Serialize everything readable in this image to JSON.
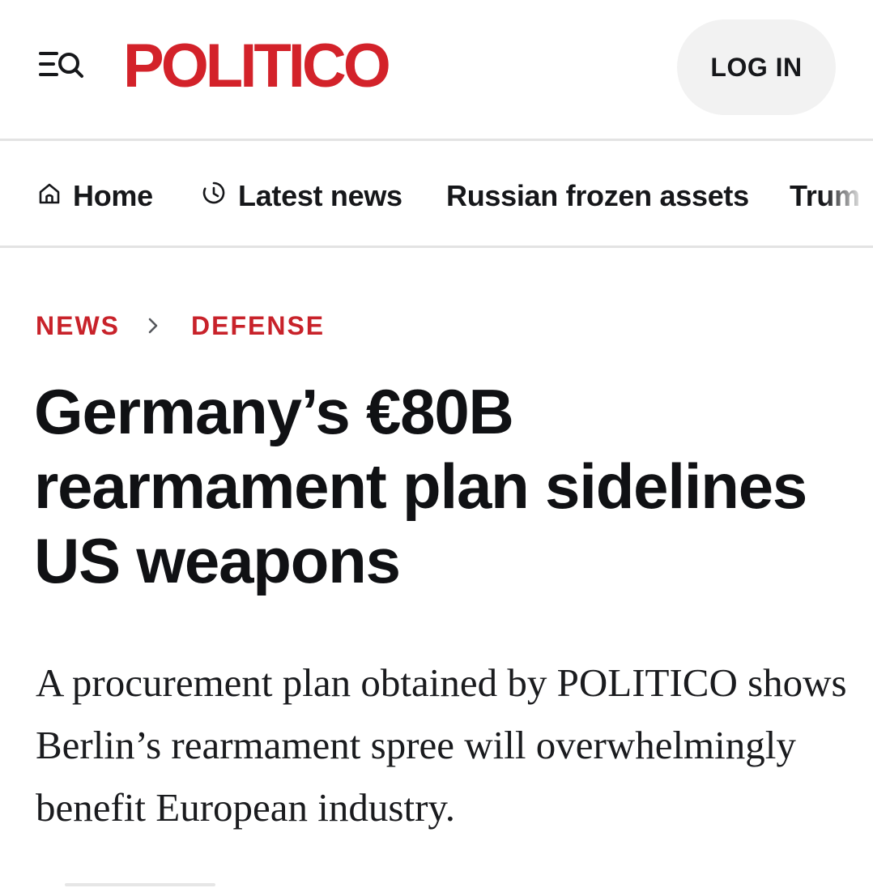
{
  "header": {
    "menu_icon": "menu-search-icon",
    "logo_text": "POLITICO",
    "login_label": "LOG IN",
    "brand_color": "#d3222a"
  },
  "nav": {
    "items": [
      {
        "label": "Home",
        "icon": "home-icon"
      },
      {
        "label": "Latest news",
        "icon": "clock-icon"
      },
      {
        "label": "Russian frozen assets"
      },
      {
        "label": "Trum"
      }
    ]
  },
  "article": {
    "breadcrumb": {
      "section": "NEWS",
      "subsection": "DEFENSE",
      "separator_icon": "chevron-right-icon"
    },
    "headline": "Germany’s €80B rearmament plan sidelines US weapons",
    "dek": "A procurement plan obtained by POLITICO shows Berlin’s rearmament spree will overwhelmingly benefit European industry."
  },
  "colors": {
    "accent": "#c8222a",
    "text": "#101114",
    "divider": "#e3e3e3",
    "login_bg": "#f2f2f2"
  }
}
